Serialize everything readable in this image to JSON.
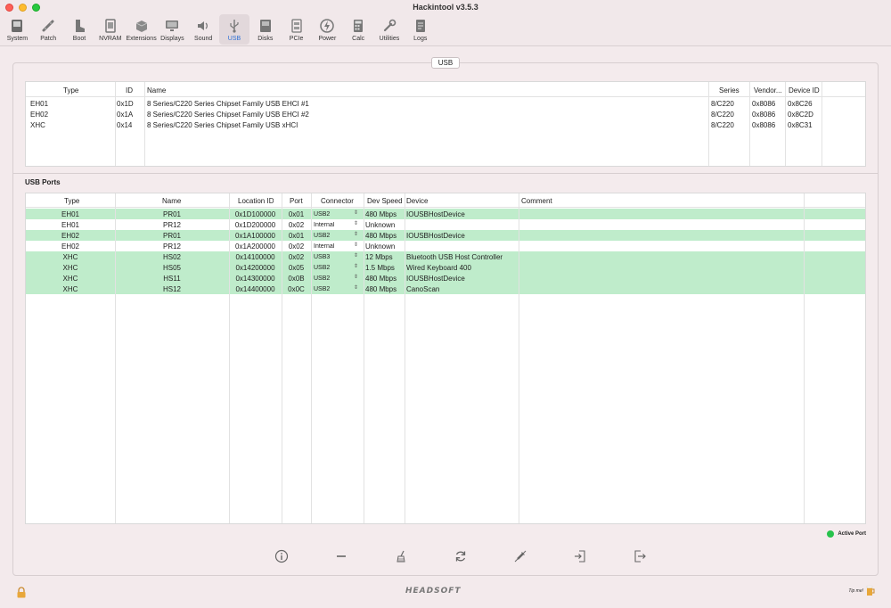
{
  "window": {
    "title": "Hackintool v3.5.3"
  },
  "toolbar": [
    {
      "label": "System",
      "icon": "system-icon"
    },
    {
      "label": "Patch",
      "icon": "patch-icon"
    },
    {
      "label": "Boot",
      "icon": "boot-icon"
    },
    {
      "label": "NVRAM",
      "icon": "nvram-icon"
    },
    {
      "label": "Extensions",
      "icon": "extensions-icon"
    },
    {
      "label": "Displays",
      "icon": "displays-icon"
    },
    {
      "label": "Sound",
      "icon": "sound-icon"
    },
    {
      "label": "USB",
      "icon": "usb-icon",
      "active": true
    },
    {
      "label": "Disks",
      "icon": "disks-icon"
    },
    {
      "label": "PCIe",
      "icon": "pcie-icon"
    },
    {
      "label": "Power",
      "icon": "power-icon"
    },
    {
      "label": "Calc",
      "icon": "calc-icon"
    },
    {
      "label": "Utilities",
      "icon": "utilities-icon"
    },
    {
      "label": "Logs",
      "icon": "logs-icon"
    }
  ],
  "group_tab": "USB",
  "controllers": {
    "headers": {
      "type": "Type",
      "id": "ID",
      "name": "Name",
      "series": "Series",
      "vendor": "Vendor...",
      "device_id": "Device ID"
    },
    "rows": [
      {
        "type": "EH01",
        "id": "0x1D",
        "name": "8 Series/C220 Series Chipset Family USB EHCI #1",
        "series": "8/C220",
        "vendor": "0x8086",
        "device_id": "0x8C26"
      },
      {
        "type": "EH02",
        "id": "0x1A",
        "name": "8 Series/C220 Series Chipset Family USB EHCI #2",
        "series": "8/C220",
        "vendor": "0x8086",
        "device_id": "0x8C2D"
      },
      {
        "type": "XHC",
        "id": "0x14",
        "name": "8 Series/C220 Series Chipset Family USB xHCI",
        "series": "8/C220",
        "vendor": "0x8086",
        "device_id": "0x8C31"
      }
    ]
  },
  "ports": {
    "title": "USB Ports",
    "headers": {
      "type": "Type",
      "name": "Name",
      "location": "Location ID",
      "port": "Port",
      "connector": "Connector",
      "speed": "Dev Speed",
      "device": "Device",
      "comment": "Comment"
    },
    "rows": [
      {
        "type": "EH01",
        "name": "PR01",
        "location": "0x1D100000",
        "port": "0x01",
        "connector": "USB2",
        "speed": "480 Mbps",
        "device": "IOUSBHostDevice",
        "comment": "",
        "active": true
      },
      {
        "type": "EH01",
        "name": "PR12",
        "location": "0x1D200000",
        "port": "0x02",
        "connector": "Internal",
        "speed": "Unknown",
        "device": "",
        "comment": "",
        "active": false
      },
      {
        "type": "EH02",
        "name": "PR01",
        "location": "0x1A100000",
        "port": "0x01",
        "connector": "USB2",
        "speed": "480 Mbps",
        "device": "IOUSBHostDevice",
        "comment": "",
        "active": true
      },
      {
        "type": "EH02",
        "name": "PR12",
        "location": "0x1A200000",
        "port": "0x02",
        "connector": "Internal",
        "speed": "Unknown",
        "device": "",
        "comment": "",
        "active": false
      },
      {
        "type": "XHC",
        "name": "HS02",
        "location": "0x14100000",
        "port": "0x02",
        "connector": "USB3",
        "speed": "12 Mbps",
        "device": "Bluetooth USB Host Controller",
        "comment": "",
        "active": true
      },
      {
        "type": "XHC",
        "name": "HS05",
        "location": "0x14200000",
        "port": "0x05",
        "connector": "USB2",
        "speed": "1.5 Mbps",
        "device": "Wired Keyboard 400",
        "comment": "",
        "active": true
      },
      {
        "type": "XHC",
        "name": "HS11",
        "location": "0x14300000",
        "port": "0x0B",
        "connector": "USB2",
        "speed": "480 Mbps",
        "device": "IOUSBHostDevice",
        "comment": "",
        "active": true
      },
      {
        "type": "XHC",
        "name": "HS12",
        "location": "0x14400000",
        "port": "0x0C",
        "connector": "USB2",
        "speed": "480 Mbps",
        "device": "CanoScan",
        "comment": "",
        "active": true
      }
    ]
  },
  "legend": {
    "label": "Active Port",
    "color": "#27c24c"
  },
  "active_row_color": "#bfeccb",
  "accent_color": "#2c6fd6",
  "footer": {
    "brand": "HEADSOFT",
    "tip": "Tip me!"
  }
}
